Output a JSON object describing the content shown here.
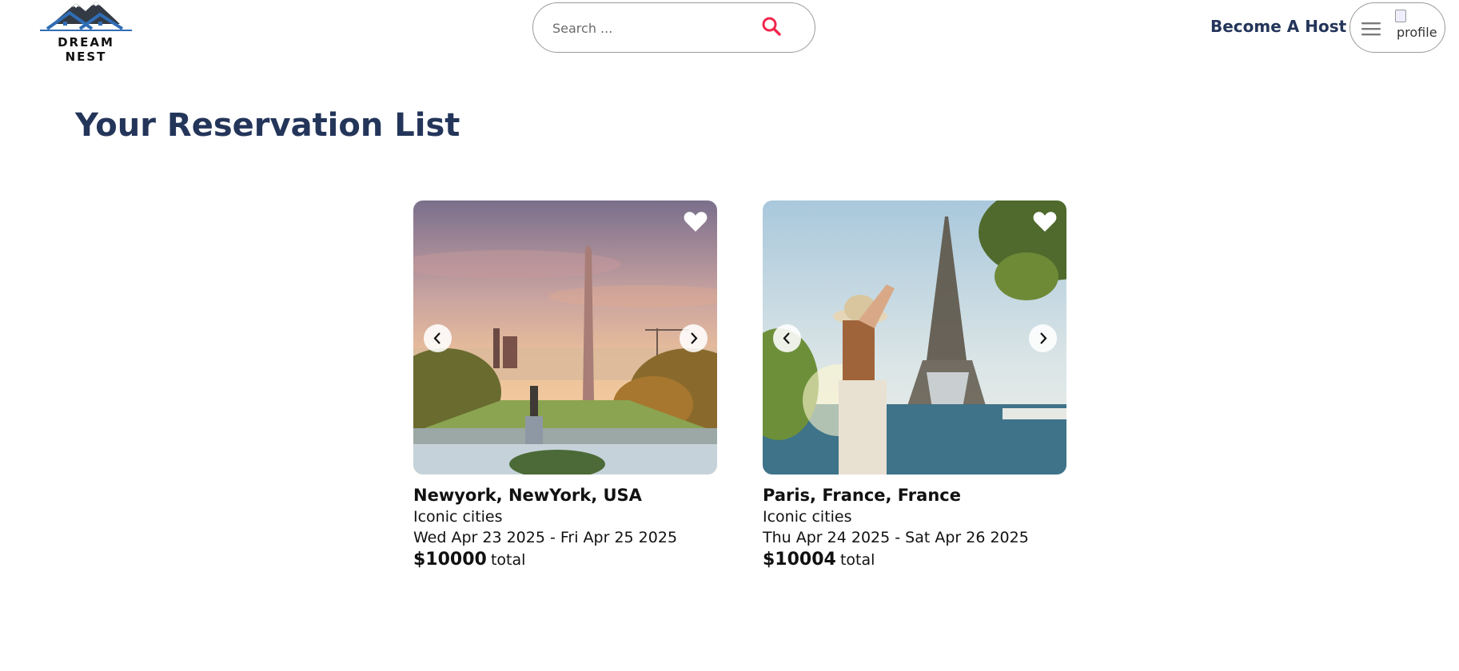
{
  "brand": {
    "name": "DREAM NEST"
  },
  "search": {
    "placeholder": "Search ..."
  },
  "header": {
    "become_host_label": "Become A Host",
    "profile_alt": "profile"
  },
  "page": {
    "title": "Your Reservation List"
  },
  "reservations": [
    {
      "location": "Newyork, NewYork, USA",
      "category": "Iconic cities",
      "dates": "Wed Apr 23 2025 - Fri Apr 25 2025",
      "price": "$10000",
      "price_suffix": "total"
    },
    {
      "location": "Paris, France, France",
      "category": "Iconic cities",
      "dates": "Thu Apr 24 2025 - Sat Apr 26 2025",
      "price": "$10004",
      "price_suffix": "total"
    }
  ],
  "icons": {
    "search": "search-icon",
    "menu": "hamburger-menu-icon",
    "favorite": "heart-icon",
    "prev": "chevron-left-icon",
    "next": "chevron-right-icon"
  },
  "colors": {
    "brand_navy": "#24355a",
    "search_accent": "#f2264b",
    "logo_blue": "#2f6db5"
  }
}
